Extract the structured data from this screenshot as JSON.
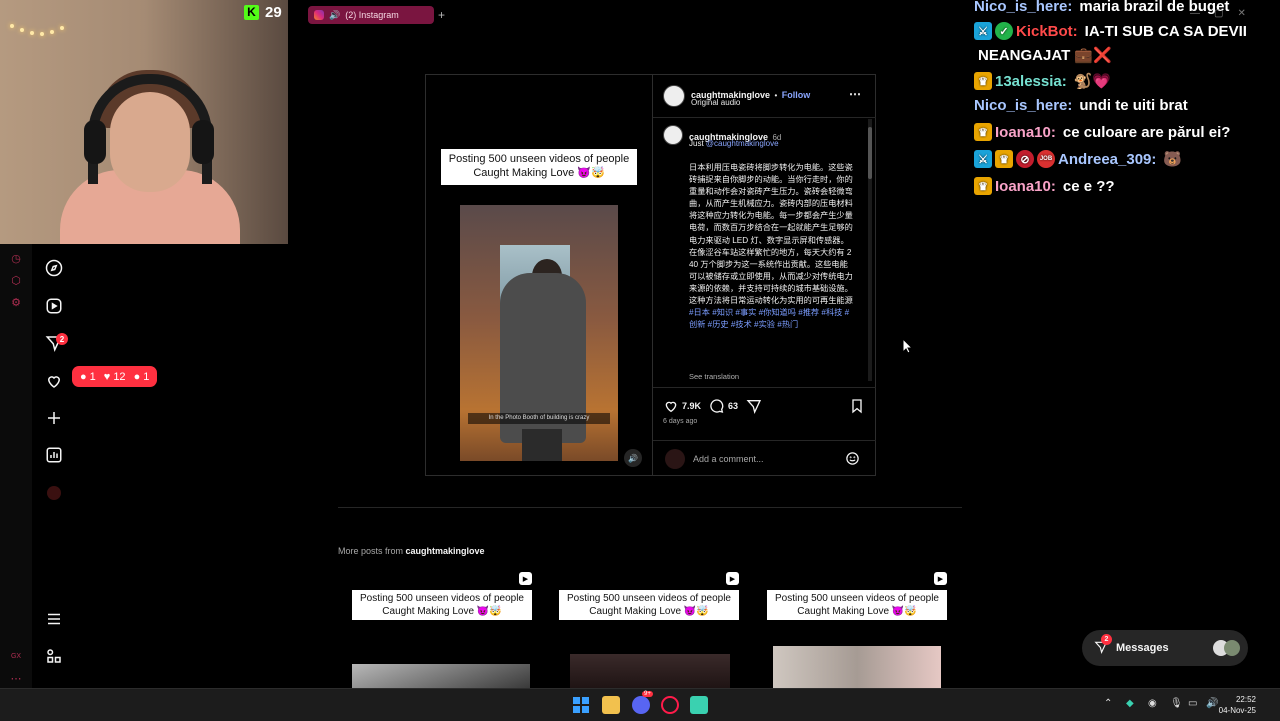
{
  "stream": {
    "kick_viewers": "29"
  },
  "browser": {
    "tab_title": "(2) Instagram",
    "new_tab": "+"
  },
  "rail": {
    "notifications_badge": "2",
    "pill": {
      "comments": "1",
      "likes": "12",
      "follows": "1"
    },
    "opera_gx": "GX"
  },
  "post": {
    "media_caption": "Posting 500 unseen videos of people Caught Making Love 😈🤯",
    "video_subtitle": "In the Photo Booth of building is crazy",
    "username": "caughtmakinglove",
    "follow": "Follow",
    "separator": "•",
    "audio": "Original audio",
    "caption_username": "caughtmakinglove",
    "caption_age": "6d",
    "caption_intro_prefix": "Just ",
    "caption_intro_mention": "@caughtmakinglove",
    "caption_text": "日本利用压电瓷砖将脚步转化为电能。这些瓷砖捕捉来自你脚步的动能。当你行走时，你的重量和动作会对瓷砖产生压力。瓷砖会轻微弯曲，从而产生机械应力。瓷砖内部的压电材料将这种应力转化为电能。每一步都会产生少量电荷，而数百万步结合在一起就能产生足够的电力来驱动 LED 灯、数字显示屏和传感器。在像涩谷车站这样繁忙的地方，每天大约有 240 万个脚步为这一系统作出贡献。这些电能可以被储存或立即使用，从而减少对传统电力来源的依赖，并支持可持续的城市基础设施。这种方法将日常运动转化为实用的可再生能源 ",
    "caption_tags": "#日本 #知识 #事实 #你知道吗 #推荐 #科技 #创新 #历史 #技术 #实验 #热门",
    "see_translation": "See translation",
    "likes": "7.9K",
    "comments": "63",
    "time_ago": "6 days ago",
    "comment_placeholder": "Add a comment..."
  },
  "more_posts": {
    "label_prefix": "More posts from ",
    "label_user": "caughtmakinglove",
    "thumbs": [
      {
        "caption": "Posting 500 unseen videos of people Caught Making Love 😈🤯"
      },
      {
        "caption": "Posting 500 unseen videos of people Caught Making Love 😈🤯"
      },
      {
        "caption": "Posting 500 unseen videos of people Caught Making Love 😈🤯"
      }
    ]
  },
  "messages": {
    "label": "Messages",
    "badge": "2"
  },
  "chat": [
    {
      "user": "Nico_is_here:",
      "color": "#a9c7ff",
      "text": "maria brazil de buget",
      "badges": []
    },
    {
      "user": "KickBot:",
      "color": "#ff4a4a",
      "text": "IA-TI SUB CA SA DEVII",
      "badges": [
        "sword",
        "check"
      ]
    },
    {
      "user": "",
      "color": "#ffffff",
      "text": "NEANGAJAT 💼❌",
      "badges": []
    },
    {
      "user": "13alessia:",
      "color": "#76e0d0",
      "text": "🐒💗",
      "badges": [
        "crown"
      ]
    },
    {
      "user": "Nico_is_here:",
      "color": "#a9c7ff",
      "text": "undi te uiti brat",
      "badges": []
    },
    {
      "user": "Ioana10:",
      "color": "#f9a3c8",
      "text": "ce culoare are părul ei?",
      "badges": [
        "crown"
      ]
    },
    {
      "user": "Andreea_309:",
      "color": "#a9c7ff",
      "text": "🐻",
      "badges": [
        "sword",
        "crown",
        "no",
        "job"
      ]
    },
    {
      "user": "Ioana10:",
      "color": "#f9a3c8",
      "text": "ce e ??",
      "badges": [
        "crown"
      ]
    }
  ],
  "taskbar": {
    "time": "22:52",
    "date": "04-Nov-25",
    "discord_badge": "9+"
  },
  "colors": {
    "accent_red": "#ff3040",
    "link_blue": "#8aa6ff",
    "opera_red": "#b02e52",
    "kick_green": "#53fc18"
  }
}
